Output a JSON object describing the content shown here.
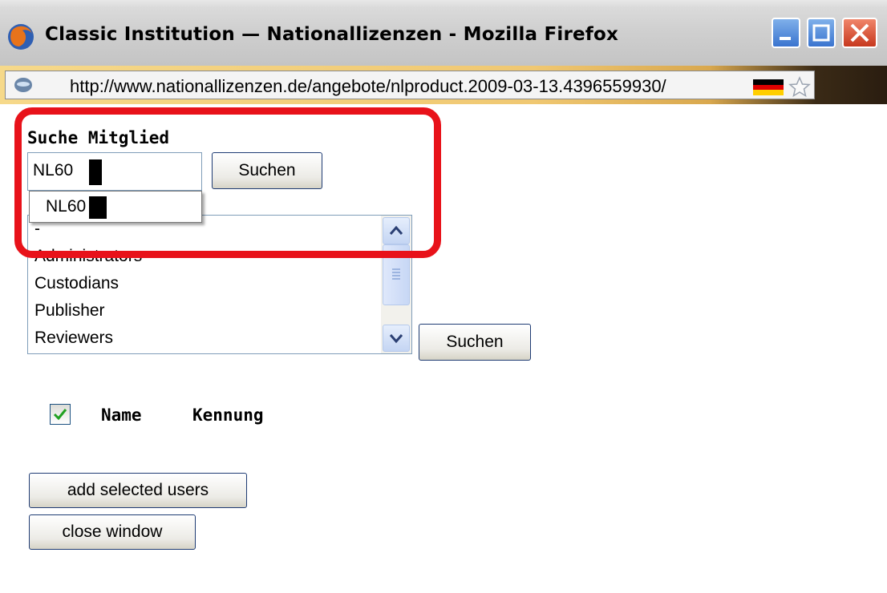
{
  "window": {
    "title": "Classic Institution — Nationallizenzen - Mozilla Firefox",
    "url": "http://www.nationallizenzen.de/angebote/nlproduct.2009-03-13.4396559930/",
    "icons": [
      "firefox-icon",
      "site-icon",
      "german-flag-icon",
      "bookmark-star-icon",
      "minimize-icon",
      "maximize-icon",
      "close-icon"
    ]
  },
  "member_search": {
    "heading": "Suche Mitglied",
    "input_value": "NL60",
    "search_button": "Suchen",
    "suggestion": "NL60"
  },
  "group_list": {
    "items": [
      "-",
      "Administrators",
      "Custodians",
      "Publisher",
      "Reviewers"
    ],
    "search_button": "Suchen"
  },
  "results_table": {
    "select_all_checked": true,
    "columns": [
      "Name",
      "Kennung"
    ]
  },
  "actions": {
    "add_button": "add selected users",
    "close_button": "close window"
  },
  "colors": {
    "highlight": "#e8121a",
    "button_border": "#1e3b73"
  }
}
